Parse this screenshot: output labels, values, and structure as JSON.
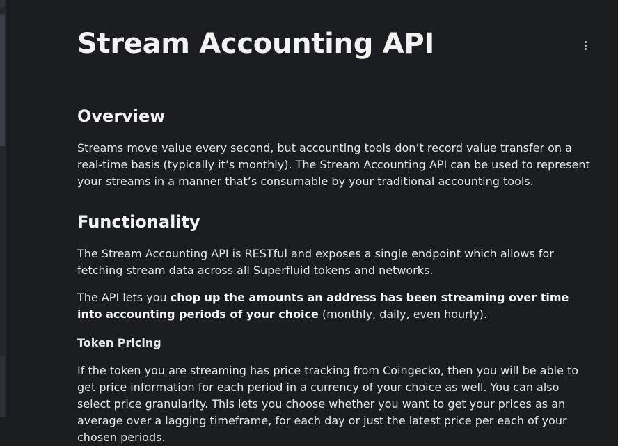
{
  "page": {
    "title": "Stream Accounting API",
    "more_icon": "more-vertical-icon"
  },
  "overview": {
    "heading": "Overview",
    "text": "Streams move value every second, but accounting tools don’t record value transfer on a real-time basis (typically it’s monthly). The Stream Accounting API can be used to represent your streams in a manner that’s consumable by your traditional accounting tools."
  },
  "functionality": {
    "heading": "Functionality",
    "paragraph1": "The Stream Accounting API is RESTful and exposes a single endpoint which allows for fetching stream data across all Superfluid tokens and networks.",
    "paragraph2_prefix": "The API lets you ",
    "paragraph2_bold": "chop up the amounts an address has been streaming over time into accounting periods of your choice",
    "paragraph2_suffix": " (monthly, daily, even hourly).",
    "pricing_label": "Token Pricing",
    "pricing_text": "If the token you are streaming has price tracking from Coingecko, then you will be able to get price information for each period in a currency of your choice as well. You can also select price granularity. This lets you choose whether you want to get your prices as an average over a lagging timeframe, for each day or just the latest price per each of your chosen periods."
  }
}
